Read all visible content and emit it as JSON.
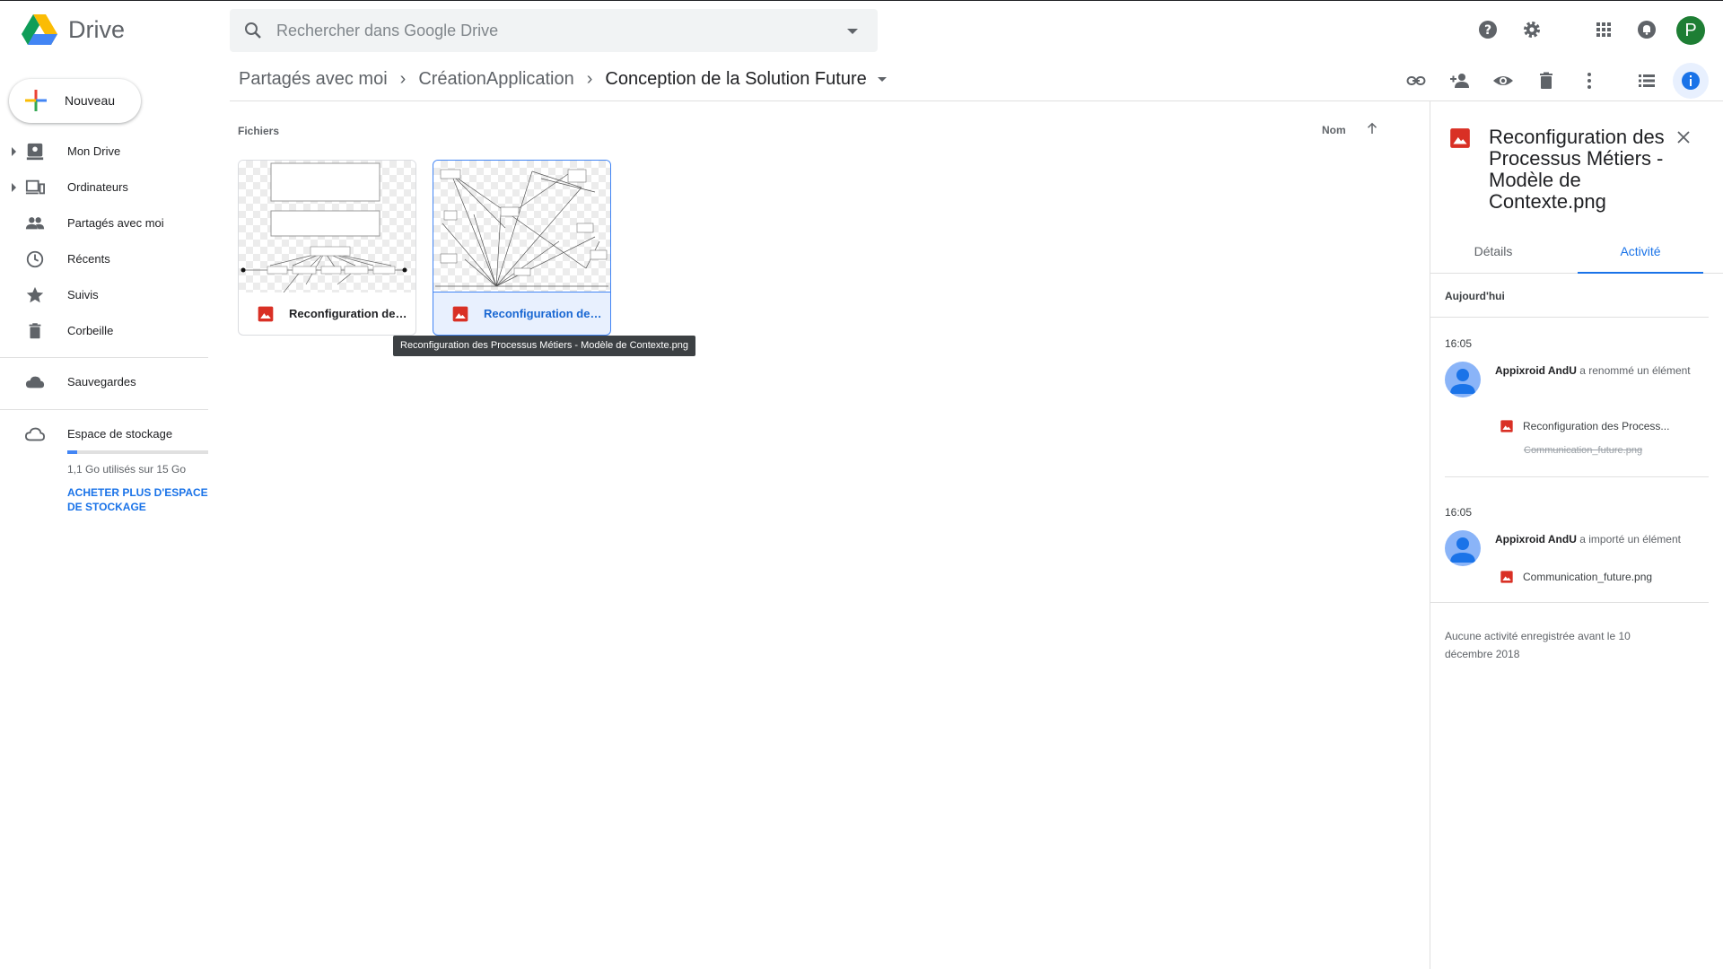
{
  "app": {
    "name": "Drive"
  },
  "search": {
    "placeholder": "Rechercher dans Google Drive"
  },
  "user": {
    "avatar_letter": "P",
    "avatar_color": "#1e7e34"
  },
  "breadcrumb": {
    "items": [
      "Partagés avec moi",
      "CréationApplication"
    ],
    "current": "Conception de la Solution Future",
    "separator": "›"
  },
  "toolbar": {
    "icons": [
      "link-icon",
      "share-person-icon",
      "preview-eye-icon",
      "trash-icon",
      "more-vert-icon",
      "list-view-icon",
      "info-icon"
    ]
  },
  "sidebar": {
    "new_label": "Nouveau",
    "items": [
      {
        "label": "Mon Drive",
        "icon": "my-drive-icon",
        "expandable": true
      },
      {
        "label": "Ordinateurs",
        "icon": "computers-icon",
        "expandable": true
      },
      {
        "label": "Partagés avec moi",
        "icon": "shared-people-icon",
        "expandable": false
      },
      {
        "label": "Récents",
        "icon": "clock-icon",
        "expandable": false
      },
      {
        "label": "Suivis",
        "icon": "star-icon",
        "expandable": false
      },
      {
        "label": "Corbeille",
        "icon": "trash-icon",
        "expandable": false
      }
    ],
    "backups_label": "Sauvegardes",
    "storage": {
      "label": "Espace de stockage",
      "usage_text": "1,1 Go utilisés sur 15 Go",
      "used_fraction": 0.073,
      "buy_more": "ACHETER PLUS D'ESPACE DE STOCKAGE"
    }
  },
  "main": {
    "section_label": "Fichiers",
    "sort_label": "Nom",
    "files": [
      {
        "name": "Reconfiguration des Processus Métiers - Modèle de Contexte.png",
        "short": "Reconfiguration des ...",
        "selected": false
      },
      {
        "name": "Reconfiguration des Processus Métiers - Modèle de Contexte.png",
        "short": "Reconfiguration des ...",
        "selected": true
      }
    ],
    "tooltip": "Reconfiguration des Processus Métiers - Modèle de Contexte.png"
  },
  "details": {
    "title": "Reconfiguration des Processus Métiers - Modèle de Contexte.png",
    "tabs": [
      "Détails",
      "Activité"
    ],
    "active_tab": "Activité",
    "day_label": "Aujourd'hui",
    "activities": [
      {
        "time": "16:05",
        "user": "Appixroid AndU",
        "action": "a renommé un élément",
        "file": "Reconfiguration des Process...",
        "old_name": "Communication_future.png"
      },
      {
        "time": "16:05",
        "user": "Appixroid AndU",
        "action": "a importé un élément",
        "file": "Communication_future.png"
      }
    ],
    "footnote": "Aucune activité enregistrée avant le 10 décembre 2018"
  },
  "colors": {
    "accent": "#1a73e8",
    "image_file": "#d93025",
    "drive_yellow": "#fbbc04",
    "drive_green": "#0f9d58",
    "drive_blue": "#4285f4"
  }
}
